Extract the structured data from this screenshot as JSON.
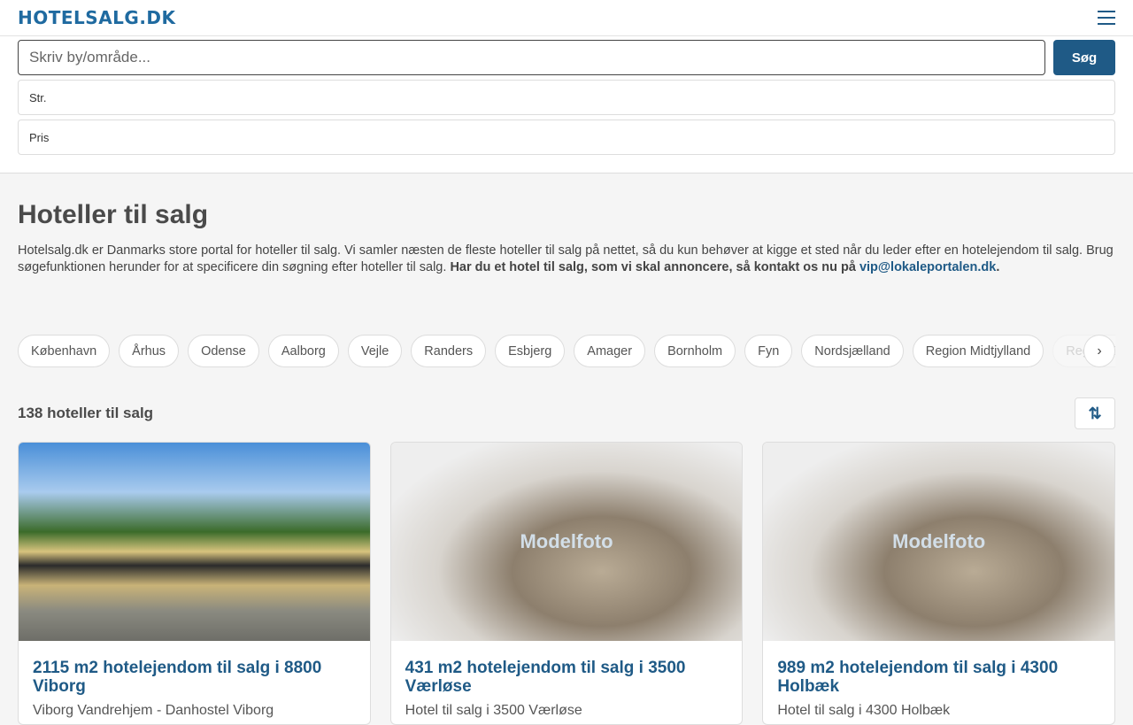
{
  "header": {
    "logo": "HOTELSALG.DK"
  },
  "search": {
    "placeholder": "Skriv by/område...",
    "button": "Søg",
    "size_label": "Str.",
    "price_label": "Pris"
  },
  "main": {
    "title": "Hoteller til salg",
    "intro": "Hotelsalg.dk er Danmarks store portal for hoteller til salg. Vi samler næsten de fleste hoteller til salg på nettet, så du kun behøver at kigge et sted når du leder efter en hotelejendom til salg. Brug søgefunktionen herunder for at specificere din søgning efter hoteller til salg. ",
    "intro_bold": "Har du et hotel til salg, som vi skal annoncere, så kontakt os nu på ",
    "email": "vip@lokaleportalen.dk",
    "period": "."
  },
  "chips": [
    "København",
    "Århus",
    "Odense",
    "Aalborg",
    "Vejle",
    "Randers",
    "Esbjerg",
    "Amager",
    "Bornholm",
    "Fyn",
    "Nordsjælland",
    "Region Midtjylland",
    "Region Syddanmark"
  ],
  "chips_next": "›",
  "results": {
    "count": "138 hoteller til salg",
    "sort_icon": "⇅"
  },
  "listings": [
    {
      "title": "2115 m2 hotelejendom til salg i 8800 Viborg",
      "subtitle": "Viborg Vandrehjem - Danhostel Viborg",
      "photo_label": ""
    },
    {
      "title": "431 m2 hotelejendom til salg i 3500 Værløse",
      "subtitle": "Hotel til salg i 3500 Værløse",
      "photo_label": "Modelfoto"
    },
    {
      "title": "989 m2 hotelejendom til salg i 4300 Holbæk",
      "subtitle": "Hotel til salg i 4300 Holbæk",
      "photo_label": "Modelfoto"
    }
  ]
}
